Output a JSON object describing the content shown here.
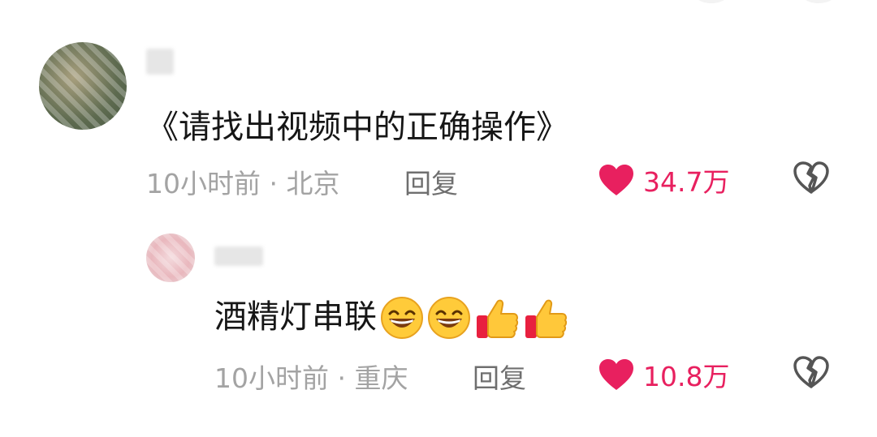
{
  "colors": {
    "like_red": "#e8205f",
    "meta_gray": "#a3a3a3",
    "reply_gray": "#6f6f6f",
    "text_dark": "#161616"
  },
  "comments": [
    {
      "text": "《请找出视频中的正确操作》",
      "time": "10小时前",
      "sep": "·",
      "location": "北京",
      "reply_label": "回复",
      "likes": "34.7万",
      "like_icon": "heart-icon",
      "dislike_icon": "broken-heart-icon"
    },
    {
      "text": "酒精灯串联",
      "emojis": [
        "grin-emoji",
        "grin-emoji",
        "thumbs-up-emoji",
        "thumbs-up-emoji"
      ],
      "time": "10小时前",
      "sep": "·",
      "location": "重庆",
      "reply_label": "回复",
      "likes": "10.8万",
      "like_icon": "heart-icon",
      "dislike_icon": "broken-heart-icon"
    }
  ]
}
